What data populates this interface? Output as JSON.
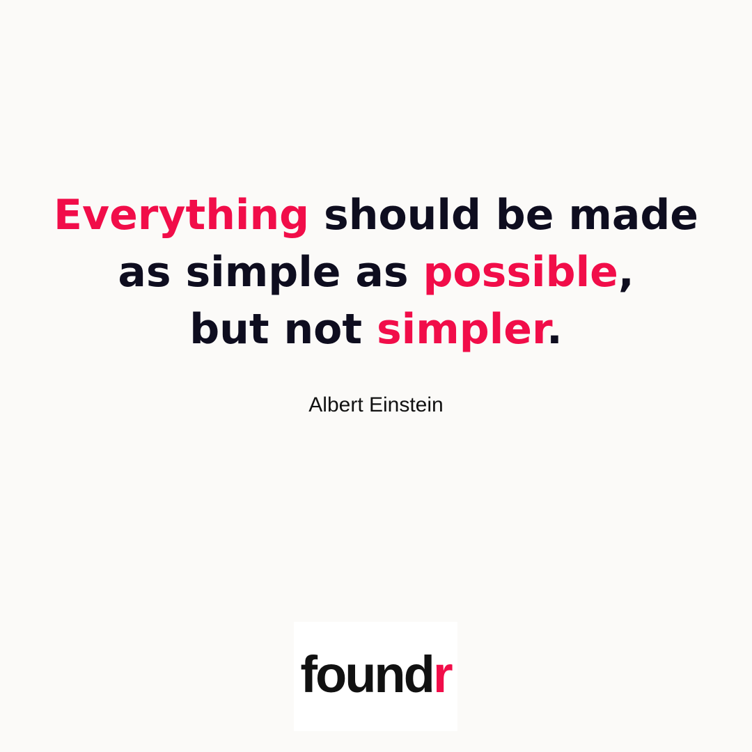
{
  "quote": {
    "line1": {
      "accent": "Everything",
      "rest": " should be made"
    },
    "line2": {
      "lead": "as simple as ",
      "accent": "possible",
      "trail": ","
    },
    "line3": {
      "lead": "but not ",
      "accent": "simpler",
      "trail": "."
    }
  },
  "author": "Albert Einstein",
  "logo": {
    "main": "found",
    "accent": "r"
  },
  "colors": {
    "background": "#fbfaf8",
    "text": "#0e0d1f",
    "accent": "#f10d49",
    "logo_box": "#ffffff"
  }
}
